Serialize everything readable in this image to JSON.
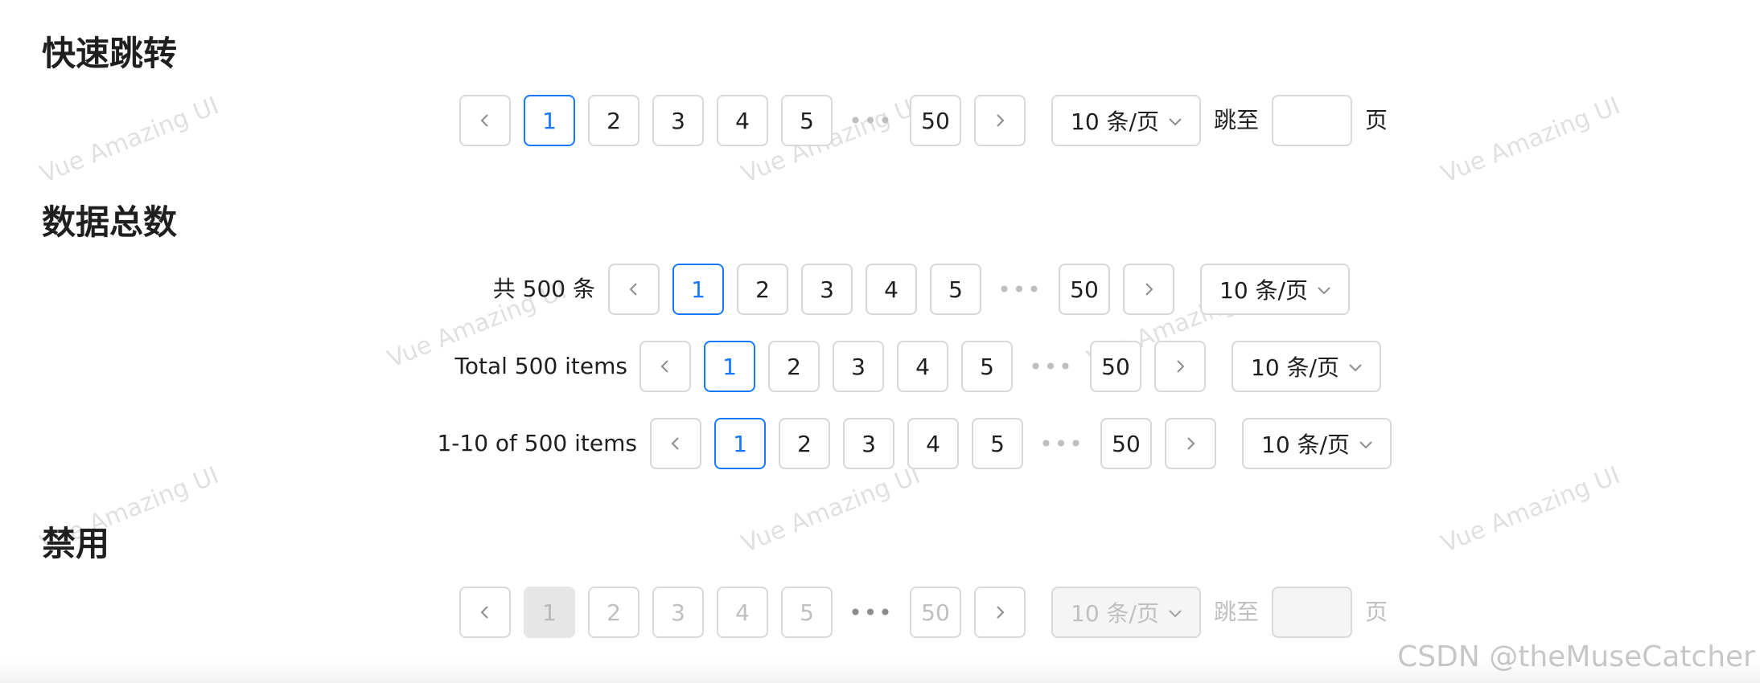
{
  "sections": {
    "quick_jump": {
      "title": "快速跳转"
    },
    "total": {
      "title": "数据总数"
    },
    "disabled": {
      "title": "禁用"
    }
  },
  "pagination": {
    "pages": [
      "1",
      "2",
      "3",
      "4",
      "5"
    ],
    "ellipsis": "•••",
    "last_page": "50",
    "page_size": "10 条/页",
    "jump_prefix": "跳至",
    "jump_suffix": "页"
  },
  "totals": {
    "row1": "共 500 条",
    "row2": "Total 500 items",
    "row3": "1-10 of 500 items"
  },
  "watermark": {
    "text": "Vue Amazing UI",
    "credit": "CSDN @theMuseCatcher"
  },
  "icons": {
    "prev": "chevron-left-icon",
    "next": "chevron-right-icon",
    "dropdown": "chevron-down-icon"
  },
  "colors": {
    "accent": "#1677ff",
    "border": "#d9d9d9",
    "disabled_text": "#bfbfbf"
  }
}
